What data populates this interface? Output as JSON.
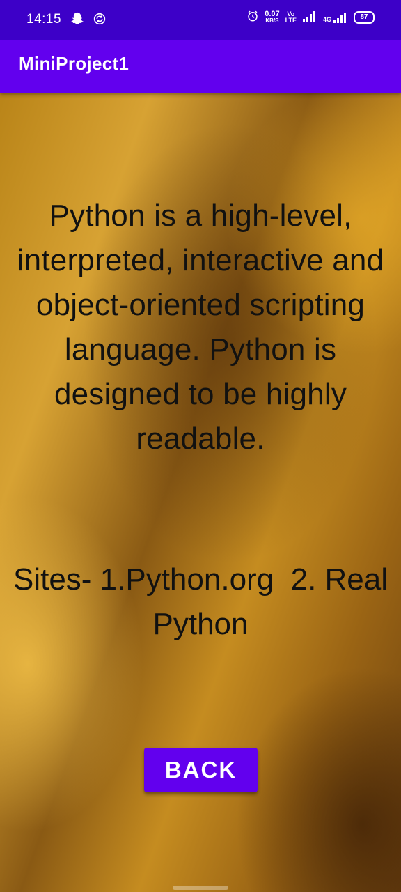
{
  "status_bar": {
    "time": "14:15",
    "net_speed_value": "0.07",
    "net_speed_unit": "KB/S",
    "volte_top": "Vo",
    "volte_bottom": "LTE",
    "network": "4G",
    "battery": "87",
    "icons": [
      "snapchat-icon",
      "sync-icon",
      "alarm-icon",
      "signal-icon",
      "signal-4g-icon",
      "battery-icon"
    ]
  },
  "app_bar": {
    "title": "MiniProject1"
  },
  "content": {
    "description": "Python is a high-level, interpreted, interactive and object-oriented scripting language. Python is designed to be highly readable.",
    "sites": "Sites- 1.Python.org  2. Real Python"
  },
  "actions": {
    "back_label": "BACK"
  },
  "colors": {
    "status_bar": "#3d00c8",
    "app_bar": "#6200ee",
    "button": "#6200ee",
    "text": "#111111"
  }
}
